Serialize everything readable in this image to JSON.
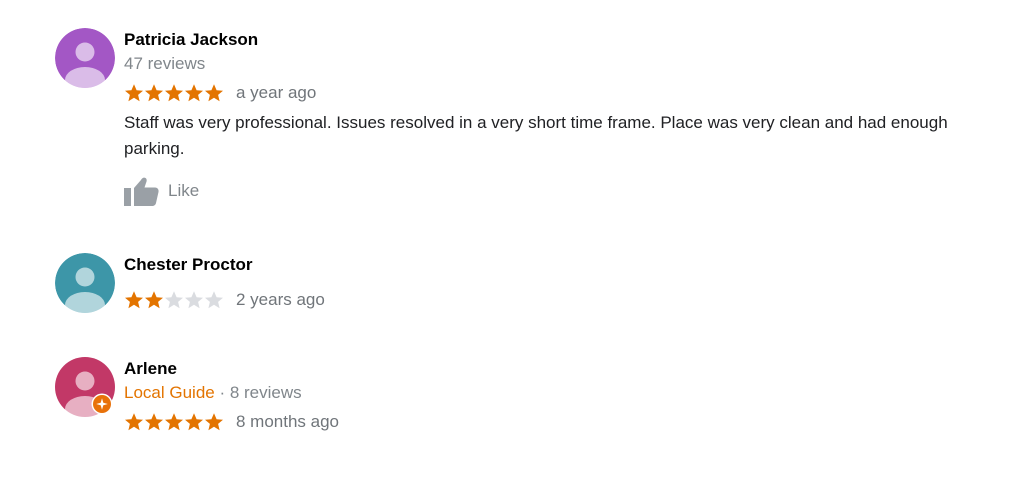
{
  "reviews": [
    {
      "name": "Patricia Jackson",
      "meta": "47 reviews",
      "rating": 5,
      "time": "a year ago",
      "text": "Staff was very professional. Issues resolved in a very short time frame. Place was very clean and had enough parking.",
      "like_label": "Like",
      "avatar_color": "#a357c5",
      "avatar_icon": "person-icon"
    },
    {
      "name": "Chester Proctor",
      "rating": 2,
      "time": "2 years ago",
      "avatar_color": "#3d96a8",
      "avatar_icon": "person-icon"
    },
    {
      "name": "Arlene",
      "guide_label": "Local Guide",
      "meta_separator": " · ",
      "meta": "8 reviews",
      "rating": 5,
      "time": "8 months ago",
      "avatar_color": "#c23867",
      "avatar_icon": "person-icon",
      "badge_icon": "local-guide-badge-icon"
    }
  ],
  "colors": {
    "star_filled": "#e37400",
    "star_empty": "#dadce0",
    "like_icon": "#9aa0a6"
  }
}
